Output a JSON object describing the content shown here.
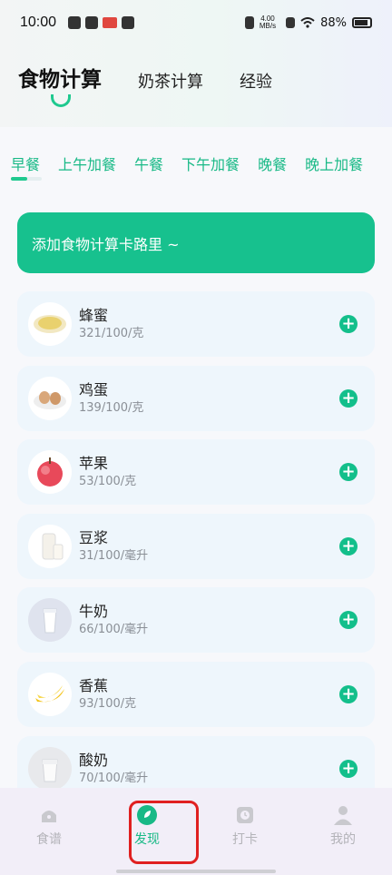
{
  "status_bar": {
    "time": "10:00",
    "network_speed_top": "4.00",
    "network_speed_unit": "MB/s",
    "battery": "88%"
  },
  "top_tabs": [
    {
      "label": "食物计算",
      "active": true
    },
    {
      "label": "奶茶计算",
      "active": false
    },
    {
      "label": "经验",
      "active": false
    }
  ],
  "meal_tabs": [
    "早餐",
    "上午加餐",
    "午餐",
    "下午加餐",
    "晚餐",
    "晚上加餐"
  ],
  "add_banner": "添加食物计算卡路里 ~",
  "foods": [
    {
      "name": "蜂蜜",
      "calories": "321/100/克",
      "icon": "honey-icon"
    },
    {
      "name": "鸡蛋",
      "calories": "139/100/克",
      "icon": "egg-icon"
    },
    {
      "name": "苹果",
      "calories": "53/100/克",
      "icon": "apple-icon"
    },
    {
      "name": "豆浆",
      "calories": "31/100/毫升",
      "icon": "soymilk-icon"
    },
    {
      "name": "牛奶",
      "calories": "66/100/毫升",
      "icon": "milk-icon"
    },
    {
      "name": "香蕉",
      "calories": "93/100/克",
      "icon": "banana-icon"
    },
    {
      "name": "酸奶",
      "calories": "70/100/毫升",
      "icon": "yogurt-icon"
    }
  ],
  "bottom_nav": [
    {
      "label": "食谱",
      "icon": "recipe-icon",
      "active": false
    },
    {
      "label": "发现",
      "icon": "discover-icon",
      "active": true
    },
    {
      "label": "打卡",
      "icon": "checkin-icon",
      "active": false
    },
    {
      "label": "我的",
      "icon": "profile-icon",
      "active": false
    }
  ],
  "colors": {
    "accent": "#17c18e",
    "card_bg": "#eef6fc",
    "highlight_box": "#e02020"
  }
}
